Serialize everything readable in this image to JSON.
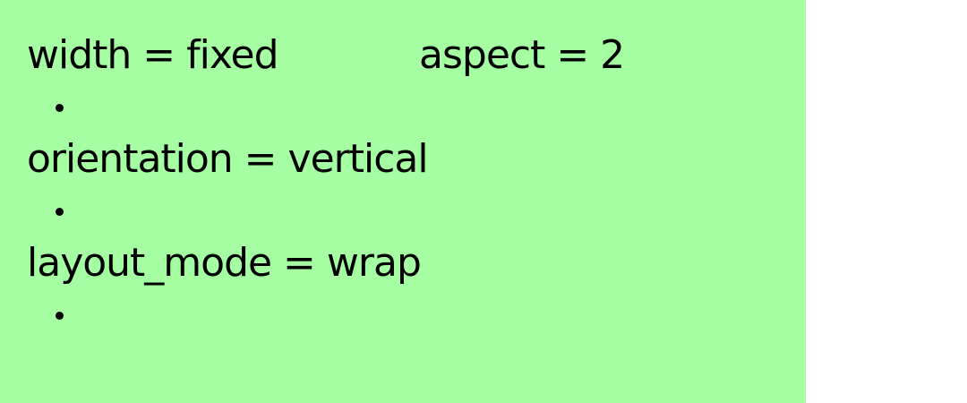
{
  "panel": {
    "background": "#a5ffa2",
    "lines": [
      {
        "text": "width = fixed"
      },
      {
        "text": "aspect = 2"
      },
      {
        "text": "orientation = vertical"
      },
      {
        "text": "layout_mode = wrap"
      }
    ]
  }
}
